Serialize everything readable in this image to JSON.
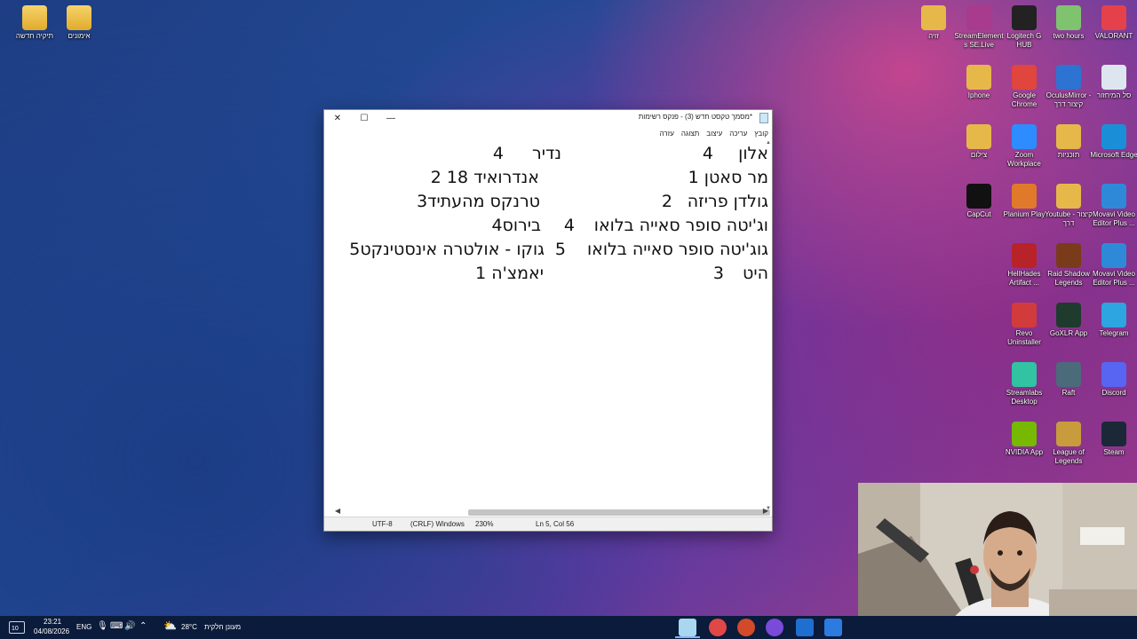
{
  "desktop_left": [
    {
      "label": "תיקיה חדשה",
      "icon": "folder-icon"
    },
    {
      "label": "אימונים",
      "icon": "folder-icon"
    }
  ],
  "desktop_right": [
    {
      "label": "VALORANT",
      "icon": "valorant-icon",
      "color": "#e5414a"
    },
    {
      "label": "two hours",
      "icon": "image-icon",
      "color": "#7fc36f"
    },
    {
      "label": "Logitech G HUB",
      "icon": "logitech-icon",
      "color": "#222222"
    },
    {
      "label": "StreamElements SE.Live",
      "icon": "streamelements-icon",
      "color": "#a83b8c"
    },
    {
      "label": "זויה",
      "icon": "folder-icon",
      "color": "#e6b84a"
    },
    {
      "label": "סל המיחזור",
      "icon": "recycle-bin-icon",
      "color": "#dde6ee"
    },
    {
      "label": "OculusMirror - קיצור דרך",
      "icon": "oculus-icon",
      "color": "#2d73d2"
    },
    {
      "label": "Google Chrome",
      "icon": "chrome-icon",
      "color": "#e0463d"
    },
    {
      "label": "Iphone",
      "icon": "folder-icon",
      "color": "#e6b84a"
    },
    {
      "label": "Microsoft Edge",
      "icon": "edge-icon",
      "color": "#1a8fd8"
    },
    {
      "label": "תוכניות",
      "icon": "folder-icon",
      "color": "#e6b84a"
    },
    {
      "label": "Zoom Workplace",
      "icon": "zoom-icon",
      "color": "#2d8cff"
    },
    {
      "label": "צילום",
      "icon": "folder-icon",
      "color": "#e6b84a"
    },
    {
      "label": "Movavi Video Editor Plus ...",
      "icon": "movavi-icon",
      "color": "#2e8ad8"
    },
    {
      "label": "Youtube - קיצור דרך",
      "icon": "youtube-folder-icon",
      "color": "#e6b84a"
    },
    {
      "label": "Planium Play",
      "icon": "planium-icon",
      "color": "#e07a2a"
    },
    {
      "label": "CapCut",
      "icon": "capcut-icon",
      "color": "#111111"
    },
    {
      "label": "Movavi Video Editor Plus ...",
      "icon": "movavi-icon",
      "color": "#2e8ad8"
    },
    {
      "label": "Raid Shadow Legends",
      "icon": "raid-icon",
      "color": "#7a3b1a"
    },
    {
      "label": "HellHades Artifact ...",
      "icon": "hellhades-icon",
      "color": "#b8232a"
    },
    {
      "label": "Telegram",
      "icon": "telegram-icon",
      "color": "#2ca5e0"
    },
    {
      "label": "GoXLR App",
      "icon": "goxlr-icon",
      "color": "#1f3b2e"
    },
    {
      "label": "Revo Uninstaller",
      "icon": "revo-icon",
      "color": "#d23b3b"
    },
    {
      "label": "Discord",
      "icon": "discord-icon",
      "color": "#5865f2"
    },
    {
      "label": "Raft",
      "icon": "raft-icon",
      "color": "#4b6b7a"
    },
    {
      "label": "Streamlabs Desktop",
      "icon": "streamlabs-icon",
      "color": "#31c3a2"
    },
    {
      "label": "Steam",
      "icon": "steam-icon",
      "color": "#1b2838"
    },
    {
      "label": "League of Legends",
      "icon": "lol-icon",
      "color": "#c89b3c"
    },
    {
      "label": "NVIDIA App",
      "icon": "nvidia-icon",
      "color": "#76b900"
    }
  ],
  "notepad": {
    "title": "*מסמך טקסט חדש (3) - פנקס רשימות",
    "menu": [
      "קובץ",
      "עריכה",
      "עיצוב",
      "תצוגה",
      "עזרה"
    ],
    "lines": [
      {
        "a": "אלון",
        "b": "4",
        "c": "נדיר",
        "d": "4"
      },
      {
        "a": "מר סאטן 1",
        "c": "אנדרואיד 18 2"
      },
      {
        "a": "גולדן פריזה",
        "b": "2",
        "c": "טרנקס מהעתיד3"
      },
      {
        "a": "וג'יטה סופר סאייה בלואו",
        "b": "4",
        "c": "בירוס4"
      },
      {
        "a": "גוג'יטה סופר סאייה בלואו",
        "b": "5",
        "c": "גוקו - אולטרה אינסטינקט5"
      },
      {
        "a": "היט",
        "b": "3",
        "c": "יאמצ'ה 1"
      }
    ],
    "status": {
      "encoding": "UTF-8",
      "eol": "(CRLF) Windows",
      "zoom": "230%",
      "position": "Ln 5, Col 56"
    }
  },
  "taskbar": {
    "time": "23:21",
    "date": "04/08/2026",
    "lang": "ENG",
    "weather_temp": "28°C",
    "weather_text": "מעונן חלקית",
    "notif_count": "10"
  }
}
